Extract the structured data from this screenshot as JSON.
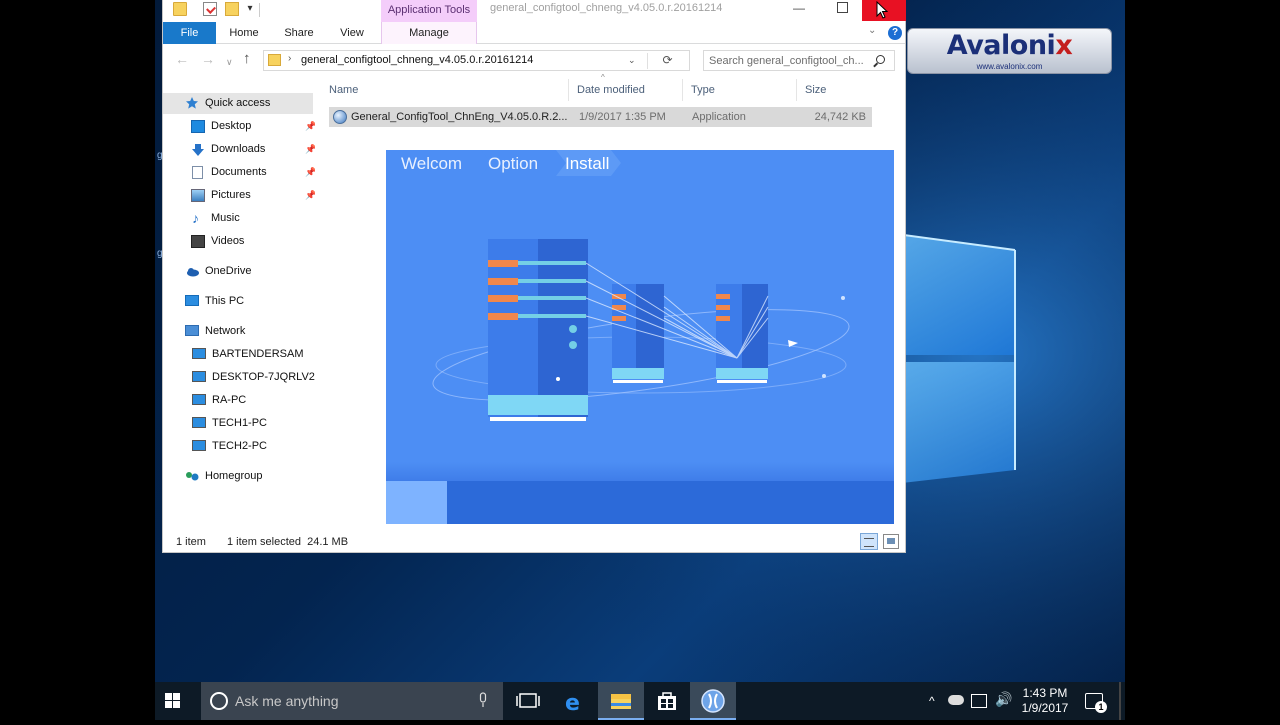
{
  "brand": {
    "name_main": "Avaloni",
    "name_x": "x",
    "url": "www.avalonix.com"
  },
  "explorer": {
    "title": "general_configtool_chneng_v4.05.0.r.20161214",
    "context_tab_header": "Application Tools",
    "ribbon_tabs": {
      "file": "File",
      "home": "Home",
      "share": "Share",
      "view": "View",
      "manage": "Manage"
    },
    "address_path": "general_configtool_chneng_v4.05.0.r.20161214",
    "search_placeholder": "Search general_configtool_ch...",
    "nav": {
      "quick_access": "Quick access",
      "items": [
        {
          "label": "Desktop",
          "icon": "desktop-icon",
          "pinned": true
        },
        {
          "label": "Downloads",
          "icon": "downloads-icon",
          "pinned": true
        },
        {
          "label": "Documents",
          "icon": "documents-icon",
          "pinned": true
        },
        {
          "label": "Pictures",
          "icon": "pictures-icon",
          "pinned": true
        },
        {
          "label": "Music",
          "icon": "music-icon",
          "pinned": false
        },
        {
          "label": "Videos",
          "icon": "videos-icon",
          "pinned": false
        }
      ],
      "onedrive": "OneDrive",
      "thispc": "This PC",
      "network": "Network",
      "network_items": [
        "BARTENDERSAM",
        "DESKTOP-7JQRLV2",
        "RA-PC",
        "TECH1-PC",
        "TECH2-PC"
      ],
      "homegroup": "Homegroup"
    },
    "columns": {
      "name": "Name",
      "date": "Date modified",
      "type": "Type",
      "size": "Size"
    },
    "files": [
      {
        "name": "General_ConfigTool_ChnEng_V4.05.0.R.2...",
        "date": "1/9/2017 1:35 PM",
        "type": "Application",
        "size": "24,742 KB"
      }
    ],
    "status": {
      "count": "1 item",
      "selected": "1 item selected  24.1 MB"
    }
  },
  "installer": {
    "steps": [
      "Welcom",
      "Option",
      "Install"
    ],
    "active_step": "Install",
    "progress": 0.12,
    "colors": {
      "bg": "#4d8ef4",
      "accent_orange": "#f0874c",
      "progress_fill": "#7eb3ff"
    }
  },
  "taskbar": {
    "search_placeholder": "Ask me anything",
    "apps": [
      "task-view-icon",
      "edge-icon",
      "file-explorer-icon",
      "store-icon",
      "configtool-icon"
    ],
    "time": "1:43 PM",
    "date": "1/9/2017",
    "notification_count": "1"
  }
}
